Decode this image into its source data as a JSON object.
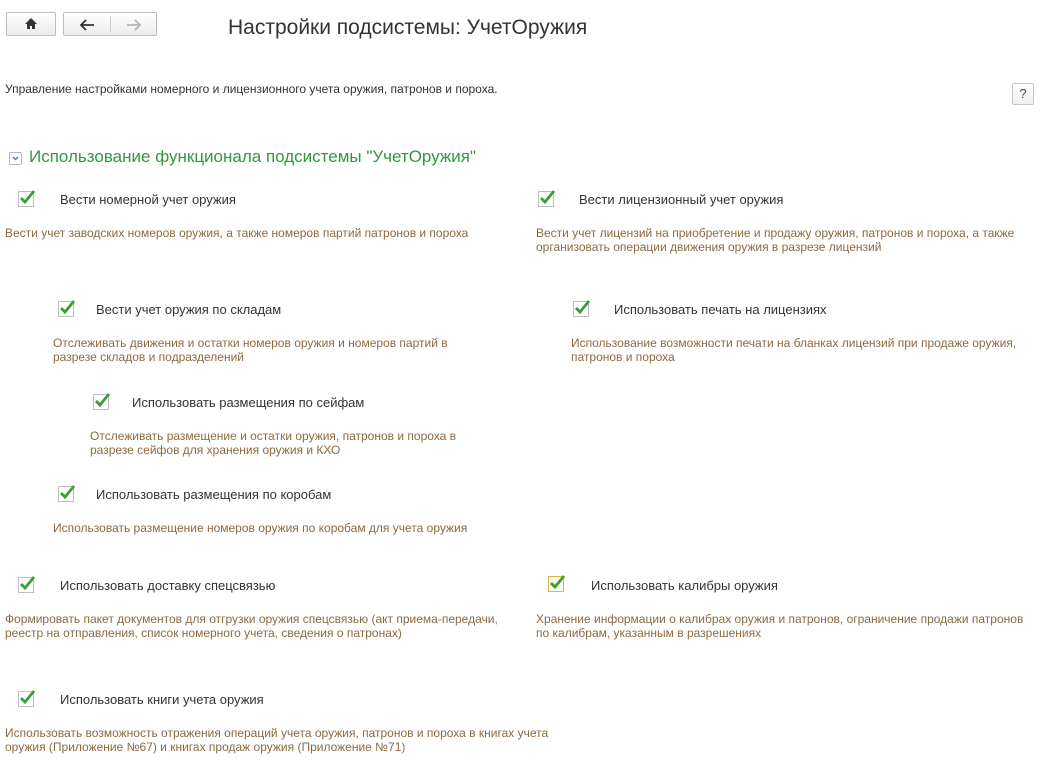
{
  "header": {
    "home_icon": "home-icon",
    "back_icon": "arrow-left-icon",
    "forward_icon": "arrow-right-icon",
    "title": "Настройки подсистемы: УчетОружия"
  },
  "description": "Управление настройками номерного и лицензионного учета оружия, патронов и пороха.",
  "help_label": "?",
  "group": {
    "title": "Использование функционала подсистемы \"УчетОружия\""
  },
  "options": {
    "serial": {
      "label": "Вести номерной учет оружия",
      "checked": true,
      "hint": "Вести учет заводских номеров оружия, а также номеров партий патронов и пороха"
    },
    "license": {
      "label": "Вести лицензионный учет оружия",
      "checked": true,
      "hint": "Вести учет лицензий на приобретение и продажу оружия, патронов и пороха, а также организовать операции движения оружия в разрезе лицензий"
    },
    "warehouses": {
      "label": "Вести учет оружия по складам",
      "checked": true,
      "hint": "Отслеживать движения и остатки номеров оружия и номеров партий в разрезе складов и подразделений"
    },
    "license_print": {
      "label": "Использовать печать на лицензиях",
      "checked": true,
      "hint": "Использование возможности печати на бланках лицензий при продаже оружия, патронов и пороха"
    },
    "safes": {
      "label": "Использовать размещения по сейфам",
      "checked": true,
      "hint": "Отслеживать размещение и остатки оружия, патронов и пороха в разрезе сейфов для хранения оружия и КХО"
    },
    "boxes": {
      "label": "Использовать размещения по коробам",
      "checked": true,
      "hint": "Использовать размещение номеров оружия по коробам для учета оружия"
    },
    "delivery": {
      "label": "Использовать доставку спецсвязью",
      "checked": true,
      "hint": "Формировать пакет документов для отгрузки оружия спецсвязью (акт приема-передачи, реестр на отправления, список номерного учета, сведения о патронах)"
    },
    "calibers": {
      "label": "Использовать калибры оружия",
      "checked": true,
      "hint": "Хранение информации о калибрах оружия и патронов, ограничение продажи патронов по калибрам, указанным в разрешениях"
    },
    "books": {
      "label": "Использовать книги учета оружия",
      "checked": true,
      "hint": "Использовать возможность отражения операций учета оружия, патронов и пороха в книгах учета оружия (Приложение №67) и книгах продаж оружия (Приложение №71)"
    }
  },
  "colors": {
    "accent": "#2e9a3e",
    "hint": "#8a6a43",
    "check": "#3a9d3a"
  }
}
